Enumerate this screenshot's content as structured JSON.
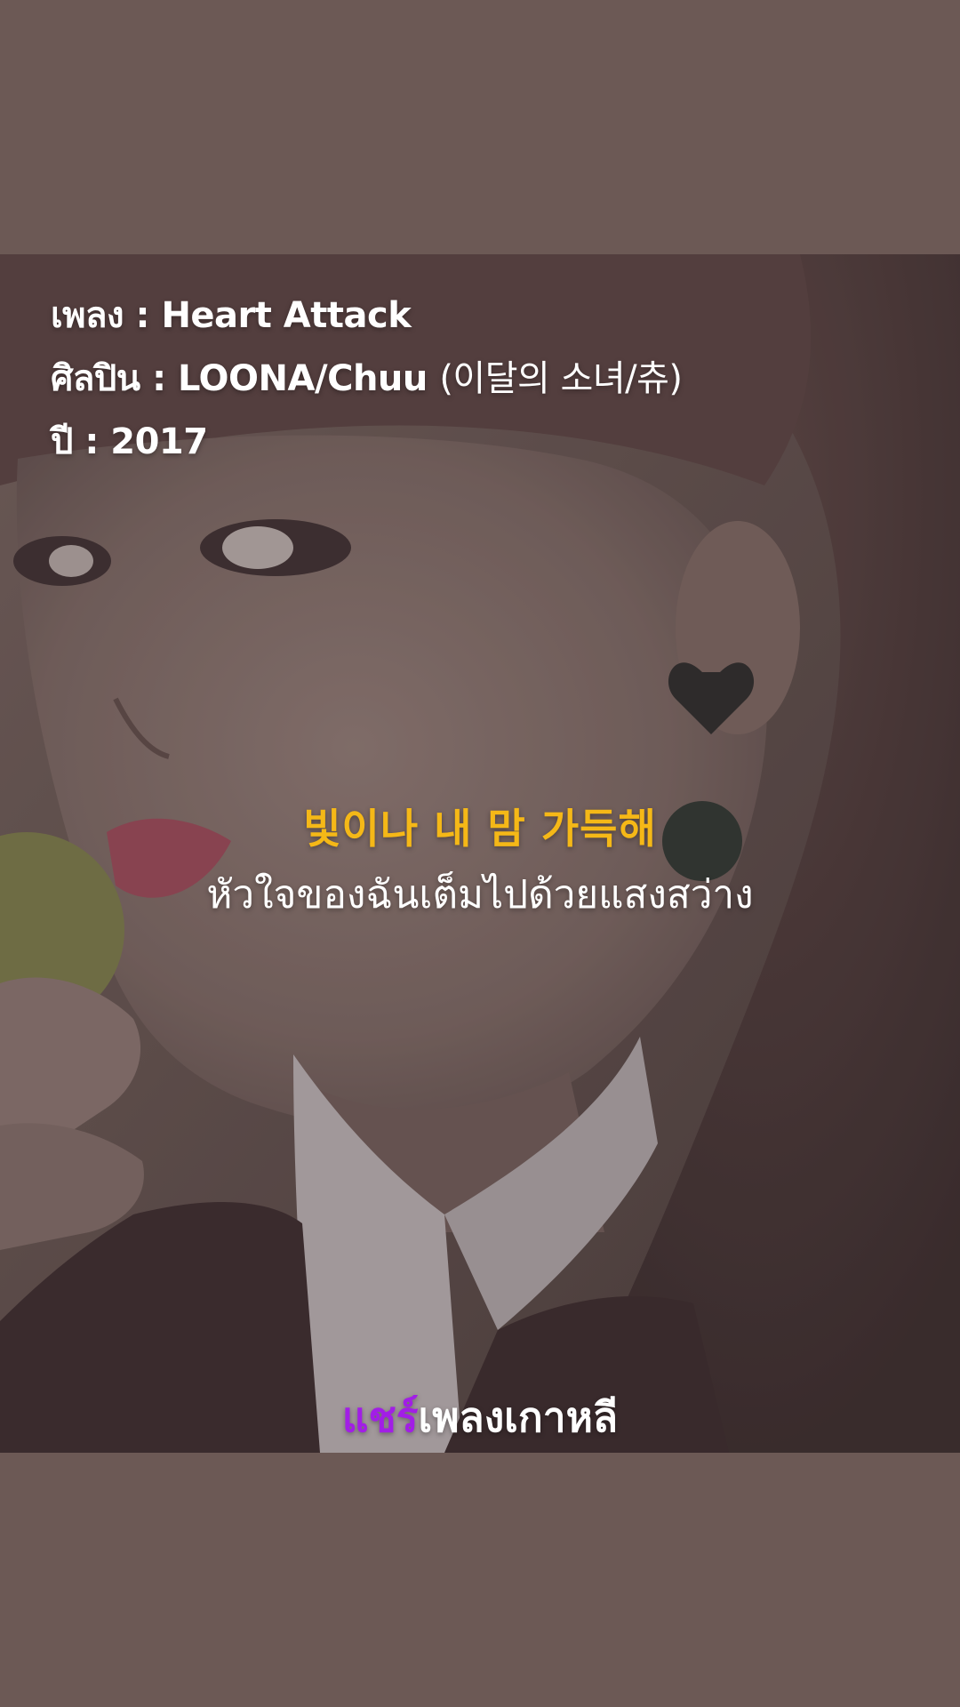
{
  "info": {
    "song_label": "เพลง : ",
    "song_title": "Heart Attack",
    "artist_label": "ศิลปิน : ",
    "artist_en": "LOONA/Chuu ",
    "artist_kr": "(이달의 소녀/츄)",
    "year_label": "ปี : ",
    "year_value": "2017"
  },
  "lyrics": {
    "korean": "빛이나 내 맘 가득해",
    "thai": "หัวใจของฉันเต็มไปด้วยแสงสว่าง"
  },
  "brand": {
    "accent_text": "แชร์",
    "rest_text": "เพลงเกาหลี",
    "accent_color": "#a21ee6"
  },
  "colors": {
    "background": "#6c5955",
    "lyric_korean": "#f5b817",
    "lyric_thai": "#ffffff"
  }
}
